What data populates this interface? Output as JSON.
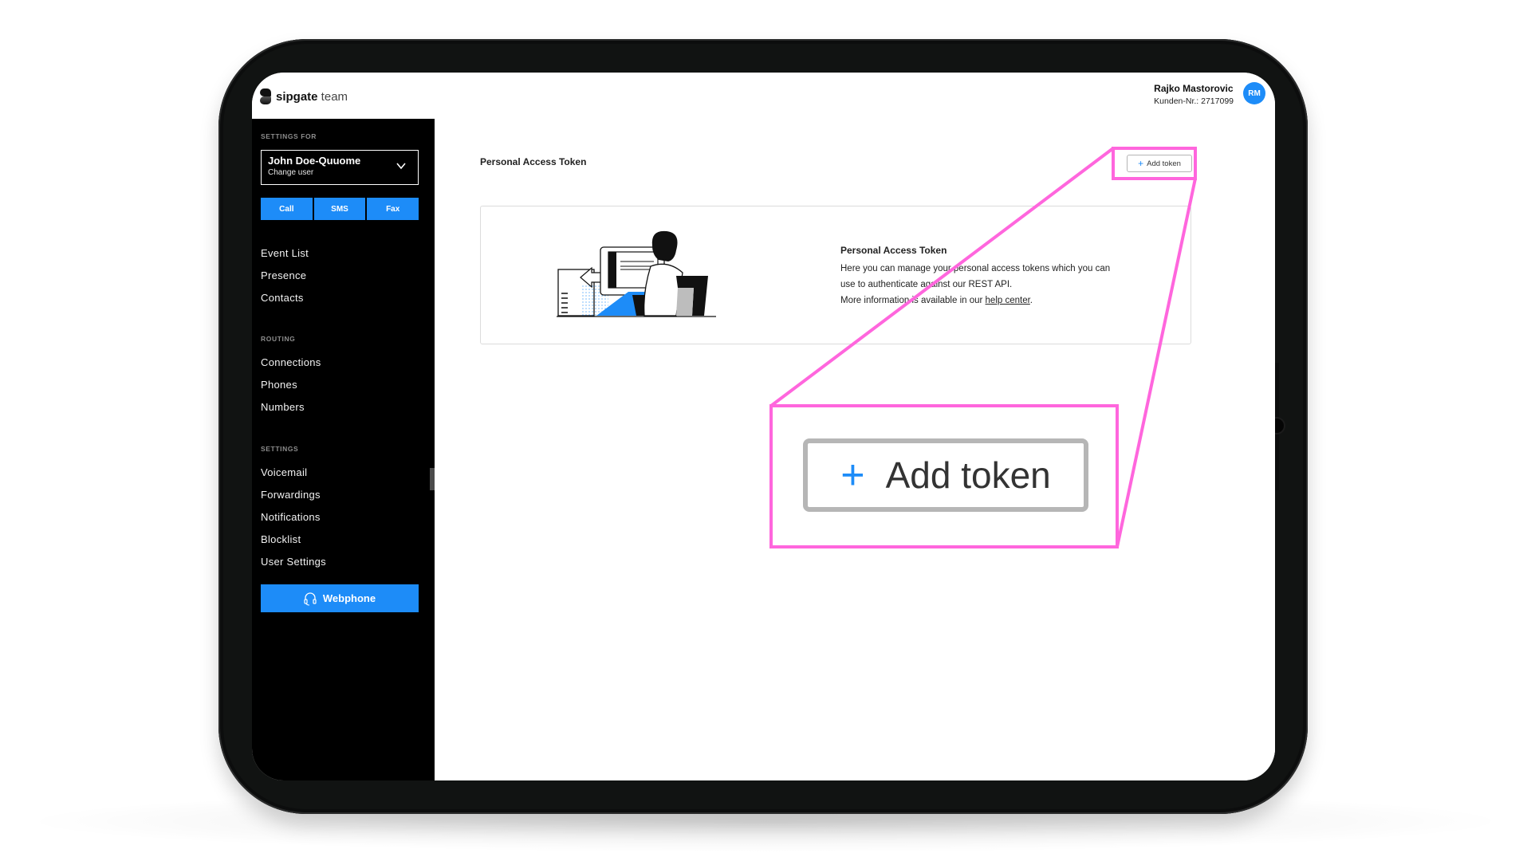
{
  "header": {
    "logo_bold": "sipgate",
    "logo_light": " team",
    "user_name": "Rajko Mastorovic",
    "customer_number": "Kunden-Nr.: 2717099",
    "avatar_initials": "RM"
  },
  "sidebar": {
    "settings_for_label": "SETTINGS FOR",
    "selected_user": "John Doe-Quuome",
    "change_user_label": "Change user",
    "actions": [
      {
        "label": "Call"
      },
      {
        "label": "SMS"
      },
      {
        "label": "Fax"
      }
    ],
    "main_items": [
      {
        "label": "Event List"
      },
      {
        "label": "Presence"
      },
      {
        "label": "Contacts"
      }
    ],
    "routing_label": "ROUTING",
    "routing_items": [
      {
        "label": "Connections"
      },
      {
        "label": "Phones"
      },
      {
        "label": "Numbers"
      }
    ],
    "settings_label": "SETTINGS",
    "settings_items": [
      {
        "label": "Voicemail"
      },
      {
        "label": "Forwardings"
      },
      {
        "label": "Notifications"
      },
      {
        "label": "Blocklist"
      },
      {
        "label": "User Settings"
      }
    ],
    "webphone_label": "Webphone"
  },
  "main": {
    "page_title": "Personal Access Token",
    "add_token_label": "Add token",
    "card": {
      "title": "Personal Access Token",
      "line1": "Here you can manage your personal access tokens which you can",
      "line2": "use to authenticate against our REST API.",
      "line3_prefix": "More information is available in our ",
      "help_link": "help center",
      "line3_suffix": "."
    }
  },
  "callout": {
    "add_token_label": "Add token"
  },
  "colors": {
    "accent": "#1d8cf8",
    "highlight": "#ff66dd",
    "sidebar_bg": "#000000"
  }
}
